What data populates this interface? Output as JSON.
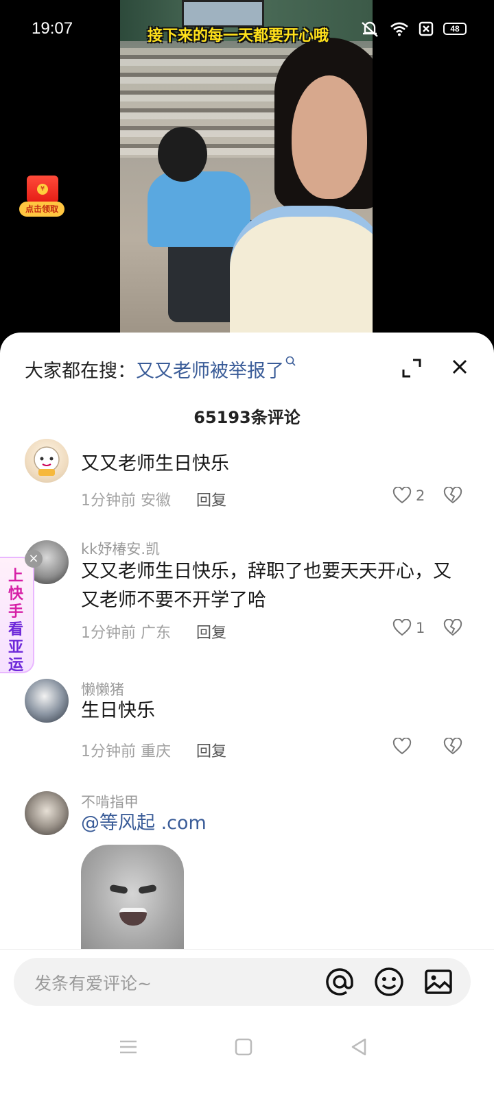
{
  "status_bar": {
    "time": "19:07",
    "battery": "48"
  },
  "video": {
    "caption": "接下来的每一天都要开心哦"
  },
  "redpack": {
    "label": "点击领取",
    "coin": "¥"
  },
  "sheet": {
    "search_prefix": "大家都在搜：",
    "search_keyword": "又又老师被举报了",
    "comment_count": "65193条评论"
  },
  "comments": [
    {
      "user": "",
      "text": "又又老师生日快乐",
      "time": "1分钟前",
      "location": "安徽",
      "reply_label": "回复",
      "likes": "2"
    },
    {
      "user": "kk妤椿安.凯",
      "text": "又又老师生日快乐，辞职了也要天天开心，又又老师不要不开学了哈",
      "time": "1分钟前",
      "location": "广东",
      "reply_label": "回复",
      "likes": "1"
    },
    {
      "user": "懒懒猪",
      "text": "生日快乐",
      "time": "1分钟前",
      "location": "重庆",
      "reply_label": "回复",
      "likes": ""
    },
    {
      "user": "不啃指甲",
      "mention": "@等风起",
      "mention_suffix": ".com",
      "text": ""
    }
  ],
  "side_promo": {
    "line1": "上快手",
    "line2": "看亚运",
    "close": "×"
  },
  "input": {
    "placeholder": "发条有爱评论~"
  },
  "colors": {
    "link": "#3a5c98",
    "caption_yellow": "#ffe11b",
    "promo_pink": "#d61fa6"
  }
}
